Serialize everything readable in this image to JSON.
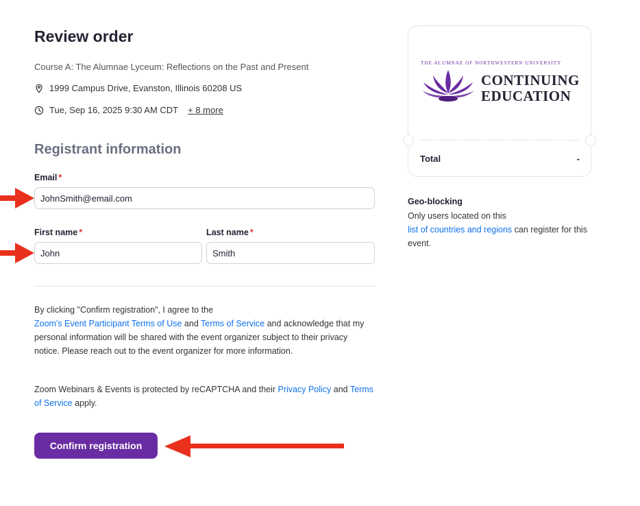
{
  "review": {
    "title": "Review order",
    "course": "Course A: The Alumnae Lyceum: Reflections on the Past and Present",
    "address": "1999 Campus Drive, Evanston, Illinois 60208 US",
    "datetime": "Tue, Sep 16, 2025 9:30 AM CDT",
    "more_link": "+ 8 more"
  },
  "registrant": {
    "section_title": "Registrant information",
    "email_label": "Email",
    "email_value": "JohnSmith@email.com",
    "first_name_label": "First name",
    "first_name_value": "John",
    "last_name_label": "Last name",
    "last_name_value": "Smith",
    "required_marker": "*"
  },
  "legal": {
    "p1_text1": "By clicking \"Confirm registration\", I agree to the",
    "p1_link1": "Zoom's Event Participant Terms of Use",
    "p1_and": "and",
    "p1_link2": "Terms of Service",
    "p1_text2": "and acknowledge that my personal information will be shared with the event organizer subject to their privacy notice. Please reach out to the event organizer for more information.",
    "p2_text1": "Zoom Webinars & Events is protected by reCAPTCHA and their",
    "p2_link1": "Privacy Policy",
    "p2_and": "and",
    "p2_link2": "Terms of Service",
    "p2_text2": "apply."
  },
  "confirm_button": "Confirm registration",
  "summary": {
    "logo_small": "THE ALUMNAE OF NORTHWESTERN UNIVERSITY",
    "logo_line1": "CONTINUING",
    "logo_line2": "EDUCATION",
    "total_label": "Total",
    "total_value": "-"
  },
  "geo": {
    "title": "Geo-blocking",
    "text1": "Only users located on this",
    "link": "list of countries and regions",
    "text2": "can register for this event."
  },
  "colors": {
    "accent": "#6a2ca2",
    "link": "#0e72ed",
    "arrow": "#e8301c"
  },
  "icons": [
    "location-pin-icon",
    "clock-icon",
    "lotus-logo-icon",
    "red-arrow"
  ]
}
